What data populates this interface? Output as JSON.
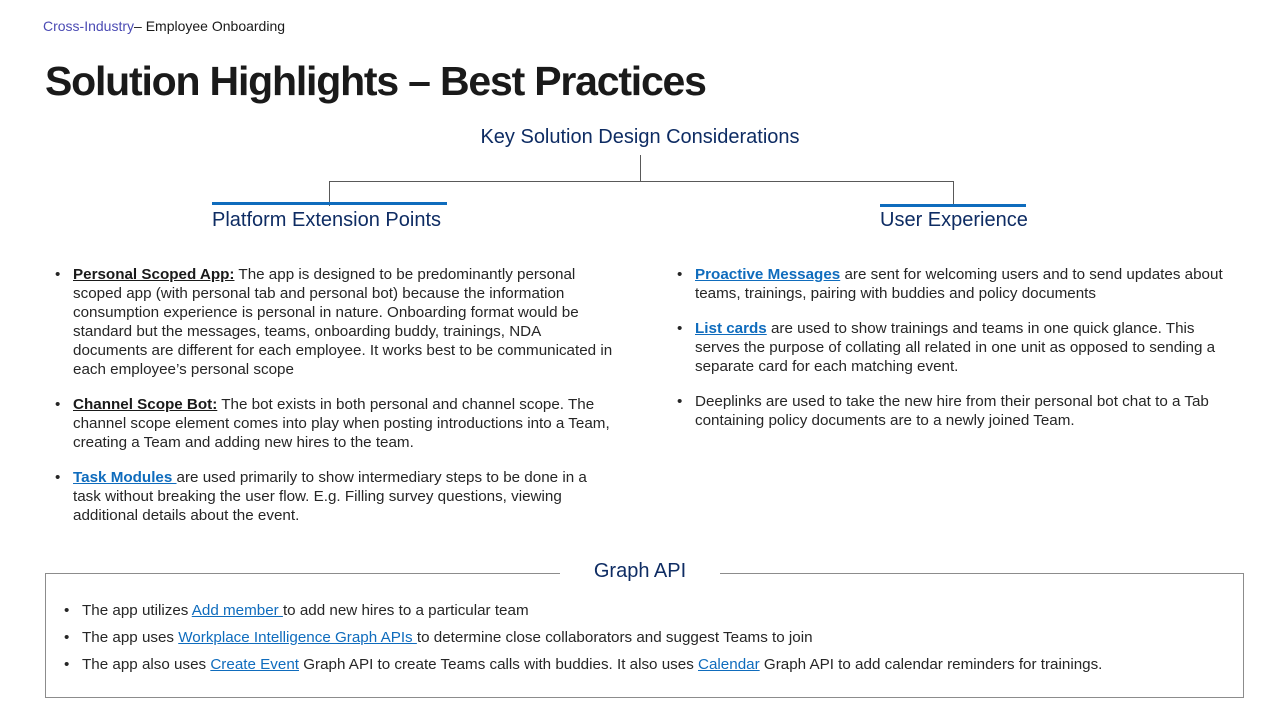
{
  "breadcrumb": {
    "category": "Cross-Industry",
    "page": "– Employee Onboarding"
  },
  "title": "Solution Highlights – Best Practices",
  "key_title": "Key Solution Design Considerations",
  "platform": {
    "heading": "Platform Extension Points",
    "items": [
      {
        "keyword": "Personal Scoped App:",
        "text": " The app is designed to be predominantly personal scoped app (with personal tab and personal bot) because the information consumption experience is personal in nature. Onboarding format would be standard but the messages, teams, onboarding buddy, trainings, NDA documents are different for each employee. It works best to be communicated in each employee’s personal scope"
      },
      {
        "keyword": "Channel Scope Bot:",
        "text": " The bot exists in both personal and channel scope. The channel scope element comes into play when posting introductions into a Team, creating a Team and adding new hires to the team."
      },
      {
        "keyword": "Task Modules ",
        "text": "are used primarily to show intermediary steps to be done in a task without breaking the user flow. E.g. Filling survey questions, viewing additional details about the event."
      }
    ]
  },
  "ux": {
    "heading": "User Experience",
    "items": [
      {
        "keyword": "Proactive Messages",
        "text": " are sent for welcoming users and to send updates about teams, trainings, pairing with buddies and policy documents"
      },
      {
        "keyword": "List cards",
        "text": " are used to show trainings and teams in one quick glance. This serves the purpose of collating all related in one unit as opposed to sending a separate card for each matching event."
      },
      {
        "text": "Deeplinks are used to take the new hire from their personal bot chat to a Tab containing policy documents are to a newly joined Team."
      }
    ]
  },
  "graph": {
    "heading": "Graph API",
    "items": [
      {
        "pre": "The app utilizes ",
        "link": "Add member ",
        "post": "to add new hires to a particular team"
      },
      {
        "pre": "The app uses ",
        "link": "Workplace Intelligence Graph APIs ",
        "post": "to determine close collaborators and suggest Teams to join"
      },
      {
        "pre": "The app also uses ",
        "link": "Create Event",
        "mid": " Graph API to create Teams calls with buddies. It also uses ",
        "link2": "Calendar",
        "post": " Graph API to add calendar reminders for trainings."
      }
    ]
  },
  "colors": {
    "accent": "#0f6cbd",
    "heading": "#0e2c63",
    "breadcrumb": "#4b4bb4"
  }
}
